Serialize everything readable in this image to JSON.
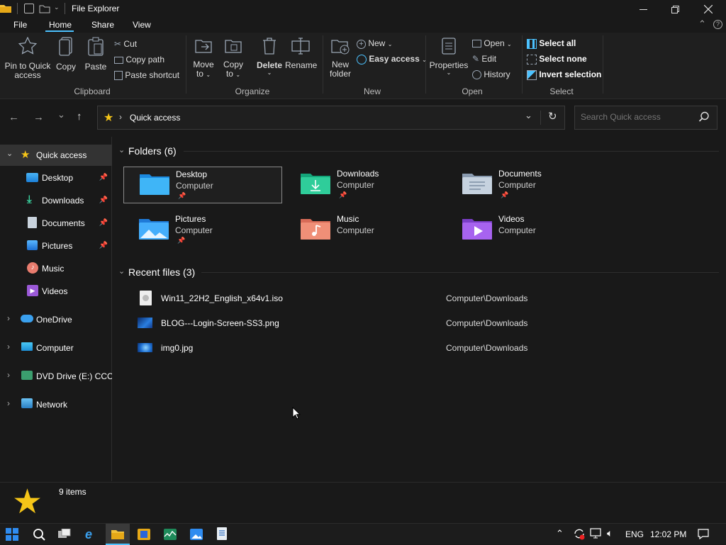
{
  "window": {
    "title": "File Explorer"
  },
  "ribbon_tabs": [
    "File",
    "Home",
    "Share",
    "View"
  ],
  "ribbon": {
    "clipboard": {
      "pin_label": "Pin to Quick access",
      "pin_line1": "Pin to Quick",
      "pin_line2": "access",
      "copy": "Copy",
      "paste": "Paste",
      "cut": "Cut",
      "copy_path": "Copy path",
      "paste_shortcut": "Paste shortcut",
      "group": "Clipboard"
    },
    "organize": {
      "move_to_1": "Move",
      "move_to_2": "to",
      "copy_to_1": "Copy",
      "copy_to_2": "to",
      "delete": "Delete",
      "rename": "Rename",
      "group": "Organize"
    },
    "new": {
      "new_folder_1": "New",
      "new_folder_2": "folder",
      "new_item": "New",
      "easy_access": "Easy access",
      "group": "New"
    },
    "open": {
      "properties": "Properties",
      "open": "Open",
      "edit": "Edit",
      "history": "History",
      "group": "Open"
    },
    "select": {
      "select_all": "Select all",
      "select_none": "Select none",
      "invert_selection": "Invert selection",
      "group": "Select"
    }
  },
  "address": {
    "path": "Quick access",
    "search_placeholder": "Search Quick access"
  },
  "nav": {
    "quick_access": "Quick access",
    "items": [
      {
        "label": "Desktop",
        "pinned": true
      },
      {
        "label": "Downloads",
        "pinned": true
      },
      {
        "label": "Documents",
        "pinned": true
      },
      {
        "label": "Pictures",
        "pinned": true
      },
      {
        "label": "Music",
        "pinned": false
      },
      {
        "label": "Videos",
        "pinned": false
      }
    ],
    "onedrive": "OneDrive",
    "computer": "Computer",
    "dvd": "DVD Drive (E:) CCCC",
    "network": "Network"
  },
  "folders": {
    "header": "Folders (6)",
    "items": [
      {
        "name": "Desktop",
        "location": "Computer",
        "pinned": true
      },
      {
        "name": "Downloads",
        "location": "Computer",
        "pinned": true
      },
      {
        "name": "Documents",
        "location": "Computer",
        "pinned": true
      },
      {
        "name": "Pictures",
        "location": "Computer",
        "pinned": true
      },
      {
        "name": "Music",
        "location": "Computer",
        "pinned": false
      },
      {
        "name": "Videos",
        "location": "Computer",
        "pinned": false
      }
    ]
  },
  "recent": {
    "header": "Recent files (3)",
    "files": [
      {
        "name": "Win11_22H2_English_x64v1.iso",
        "location": "Computer\\Downloads"
      },
      {
        "name": "BLOG---Login-Screen-SS3.png",
        "location": "Computer\\Downloads"
      },
      {
        "name": "img0.jpg",
        "location": "Computer\\Downloads"
      }
    ]
  },
  "status": {
    "items": "9 items"
  },
  "taskbar": {
    "language": "ENG",
    "time": "12:02 PM"
  },
  "colors": {
    "accent": "#4cc2ff",
    "folder_yellow": "#f5c518",
    "selection_border": "#8a8a8a"
  }
}
